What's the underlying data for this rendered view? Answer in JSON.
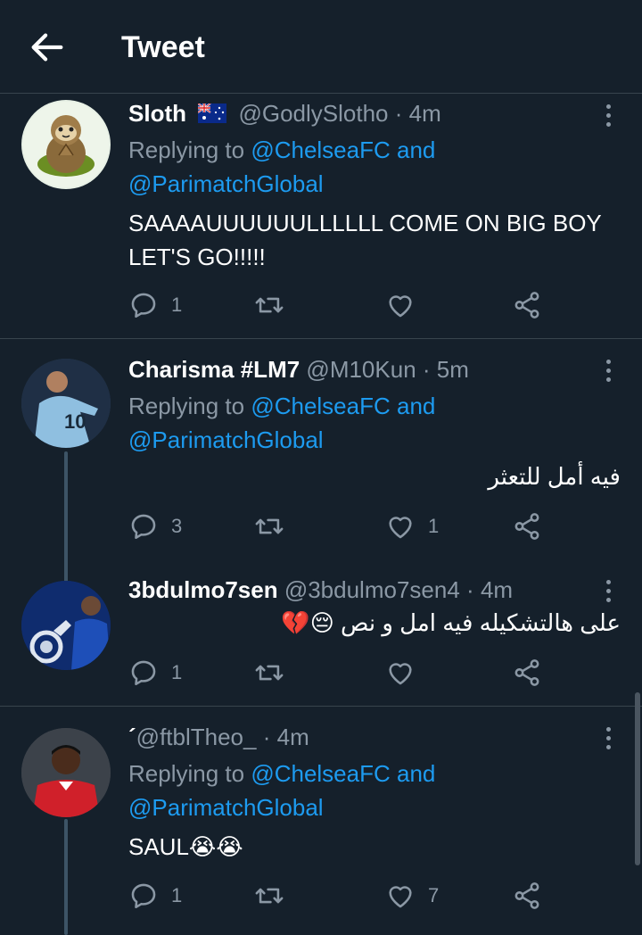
{
  "header": {
    "title": "Tweet",
    "back_icon": "arrow-left-icon"
  },
  "colors": {
    "background": "#15202b",
    "accent": "#1d9bf0",
    "muted": "#8b98a5",
    "divider": "#38444d"
  },
  "tweets": [
    {
      "name": "Sloth",
      "flag_icon": "australia-flag-icon",
      "handle": "@GodlySlotho",
      "time": "4m",
      "replying_prefix": "Replying to",
      "mention1": "@ChelseaFC",
      "and": "and",
      "mention2": "@ParimatchGlobal",
      "text_line1": "SAAAAUUUUUULLLLLL COME ON BIG BOY",
      "text_line2": "LET'S GO!!!!!",
      "replies": "1",
      "retweets": "",
      "likes": ""
    },
    {
      "name": "Charisma #LM7",
      "handle": "@M10Kun",
      "time": "5m",
      "replying_prefix": "Replying to",
      "mention1": "@ChelseaFC",
      "and": "and",
      "mention2": "@ParimatchGlobal",
      "text": "فيه أمل للتعثر",
      "replies": "3",
      "retweets": "",
      "likes": "1"
    },
    {
      "name": "3bdulmo7sen",
      "handle": "@3bdulmo7sen4",
      "time": "4m",
      "text": "على هالتشكيله فيه امل و نص 😔💔",
      "replies": "1",
      "retweets": "",
      "likes": ""
    },
    {
      "name": "´",
      "handle": "@ftblTheo_",
      "time": "4m",
      "replying_prefix": "Replying to",
      "mention1": "@ChelseaFC",
      "and": "and",
      "mention2": "@ParimatchGlobal",
      "text": "SAUL😭😭",
      "replies": "1",
      "retweets": "",
      "likes": "7"
    }
  ],
  "dot": "·"
}
